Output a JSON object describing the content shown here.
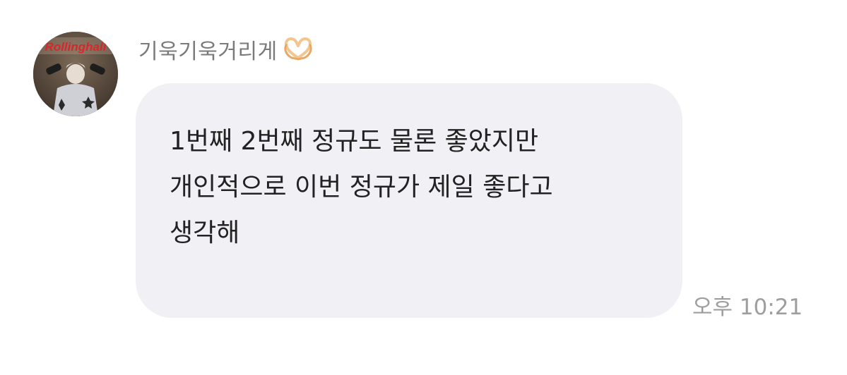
{
  "chat": {
    "sender_name": "기욱기욱거리게",
    "sender_emoji_icon": "heart-hands-icon",
    "message_text": "1번째 2번째 정규도 물론 좋았지만\n개인적으로 이번 정규가 제일 좋다고\n생각해",
    "timestamp": "오후 10:21",
    "avatar_text": "Rollinghall"
  },
  "colors": {
    "background": "#ffffff",
    "bubble": "#f1f1f5",
    "message_text": "#222222",
    "sender_name": "#7a7a7a",
    "timestamp": "#9e9e9e",
    "avatar_sign": "#d8262a"
  }
}
